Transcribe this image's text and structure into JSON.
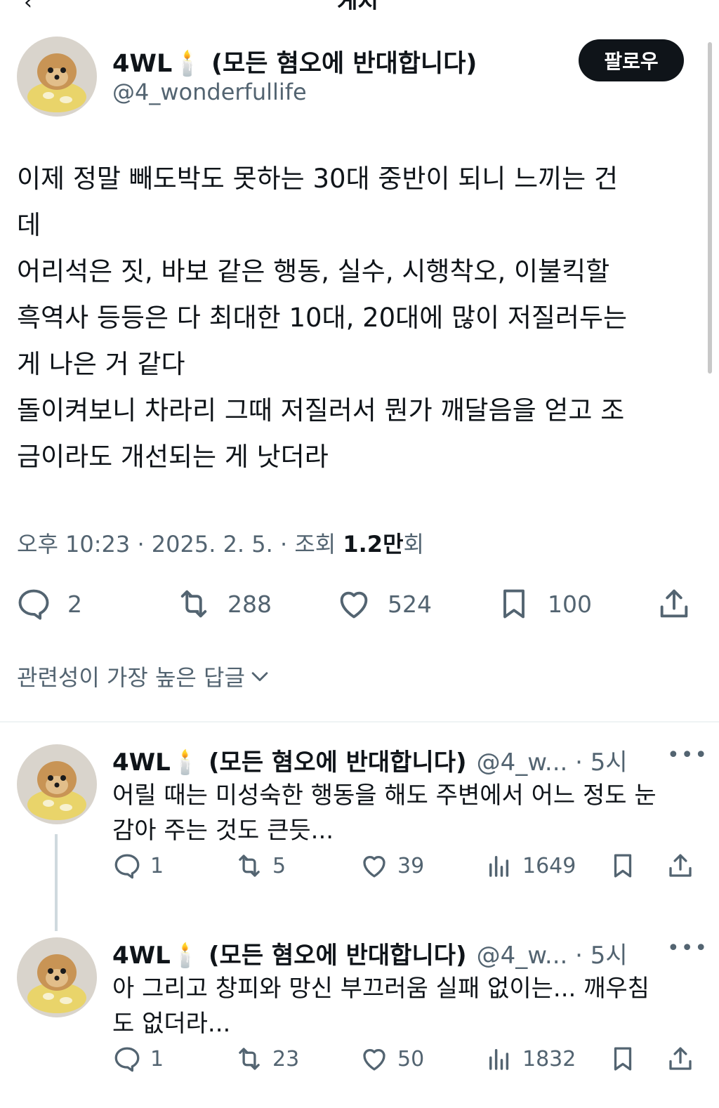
{
  "header": {
    "back_icon": "back-arrow-icon",
    "title": "게시"
  },
  "tweet": {
    "author": "4WL🕯️ (모든 혐오에 반대합니다)",
    "handle": "@4_wonderfullife",
    "follow_label": "팔로우",
    "body_lines": [
      "이제 정말 빼도박도 못하는 30대 중반이 되니 느끼는 건",
      "데",
      "어리석은 짓, 바보 같은 행동, 실수, 시행착오, 이불킥할",
      "흑역사 등등은 다 최대한 10대, 20대에 많이 저질러두는",
      "게 나은 거 같다",
      "돌이켜보니 차라리 그때 저질러서 뭔가 깨달음을 얻고 조",
      "금이라도 개선되는 게 낫더라"
    ],
    "meta": {
      "time": "오후 10:23 · 2025. 2. 5. · 조회 ",
      "views": "1.2만",
      "views_suffix": "회"
    },
    "actions": {
      "replies": "2",
      "retweets": "288",
      "likes": "524",
      "bookmarks": "100"
    }
  },
  "replies_sort_label": "관련성이 가장 높은 답글",
  "replies": [
    {
      "author": "4WL🕯️ (모든 혐오에 반대합니다)",
      "handle": "@4_w... · 5시",
      "more": "•••",
      "lines": [
        "어릴 때는 미성숙한 행동을 해도 주변에서 어느 정도 눈",
        "감아 주는 것도 큰듯..."
      ],
      "replies": "1",
      "retweets": "5",
      "likes": "39",
      "views": "1649"
    },
    {
      "author": "4WL🕯️ (모든 혐오에 반대합니다)",
      "handle": "@4_w... · 5시",
      "more": "•••",
      "lines": [
        "아 그리고 창피와 망신 부끄러움 실패 없이는... 깨우침",
        "도 없더라..."
      ],
      "replies": "1",
      "retweets": "23",
      "likes": "50",
      "views": "1832"
    }
  ]
}
